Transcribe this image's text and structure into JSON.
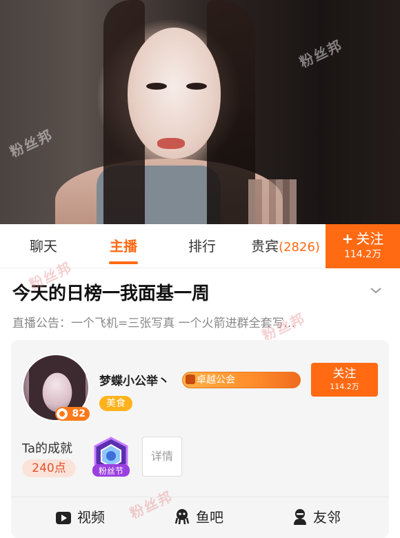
{
  "tabs": [
    {
      "label": "聊天"
    },
    {
      "label": "主播"
    },
    {
      "label": "排行"
    },
    {
      "label": "贵宾",
      "count": "(2826)"
    }
  ],
  "follow_tab": {
    "label": "关注",
    "count": "114.2万"
  },
  "room": {
    "title": "今天的日榜一我面基一周",
    "notice": "直播公告：一个飞机=三张写真 一个火箭进群全套写..."
  },
  "anchor": {
    "name": "梦蝶小公举丶",
    "guild": "卓越公会",
    "category": "美食",
    "level": "82",
    "follow_label": "关注",
    "follow_count": "114.2万"
  },
  "achievements": {
    "label": "Ta的成就",
    "points": "240点",
    "medal_text": "粉丝节",
    "detail_label": "详情"
  },
  "bottom_nav": [
    {
      "label": "视频",
      "icon": "play-icon"
    },
    {
      "label": "鱼吧",
      "icon": "octopus-icon"
    },
    {
      "label": "友邻",
      "icon": "person-icon"
    }
  ],
  "watermark": "粉丝邦",
  "colors": {
    "accent": "#ff6a13",
    "guild": "#ff8c2a",
    "category": "#ffb21c"
  }
}
